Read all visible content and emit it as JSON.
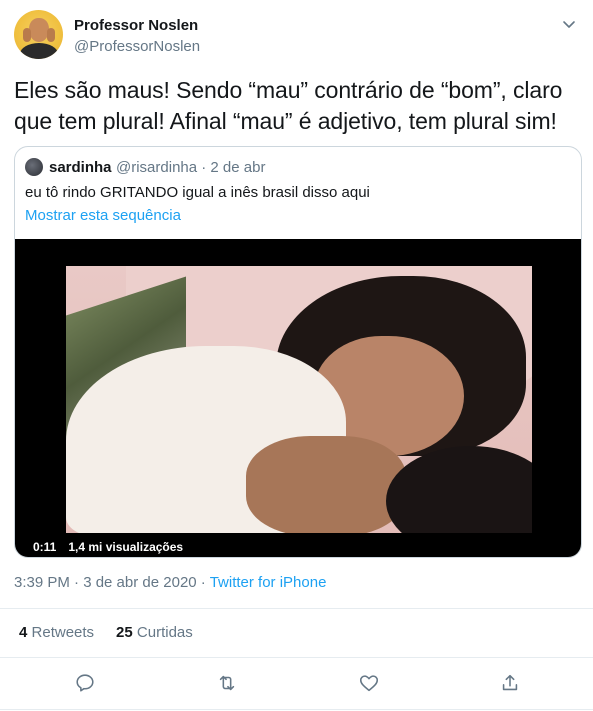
{
  "author": {
    "name": "Professor Noslen",
    "handle": "@ProfessorNoslen"
  },
  "tweet": {
    "text": "Eles são maus! Sendo “mau” contrário de “bom”, claro que tem plural! Afinal “mau” é adjetivo, tem plural sim!",
    "timestamp": "3:39 PM · 3 de abr de 2020 · ",
    "source": "Twitter for iPhone"
  },
  "quoted": {
    "name": "sardinha",
    "handle_date": "@risardinha · 2 de abr",
    "text": "eu tô rindo GRITANDO igual a inês brasil disso aqui",
    "show_thread": "Mostrar esta sequência",
    "video": {
      "duration": "0:11",
      "views": "1,4 mi visualizações"
    }
  },
  "stats": {
    "retweets_count": "4",
    "retweets_label": "Retweets",
    "likes_count": "25",
    "likes_label": "Curtidas"
  },
  "colors": {
    "accent": "#1da1f2",
    "secondary_text": "#657786",
    "border": "#e6ecf0"
  },
  "icons": [
    "chevron-down-icon",
    "reply-icon",
    "retweet-icon",
    "like-icon",
    "share-icon"
  ]
}
